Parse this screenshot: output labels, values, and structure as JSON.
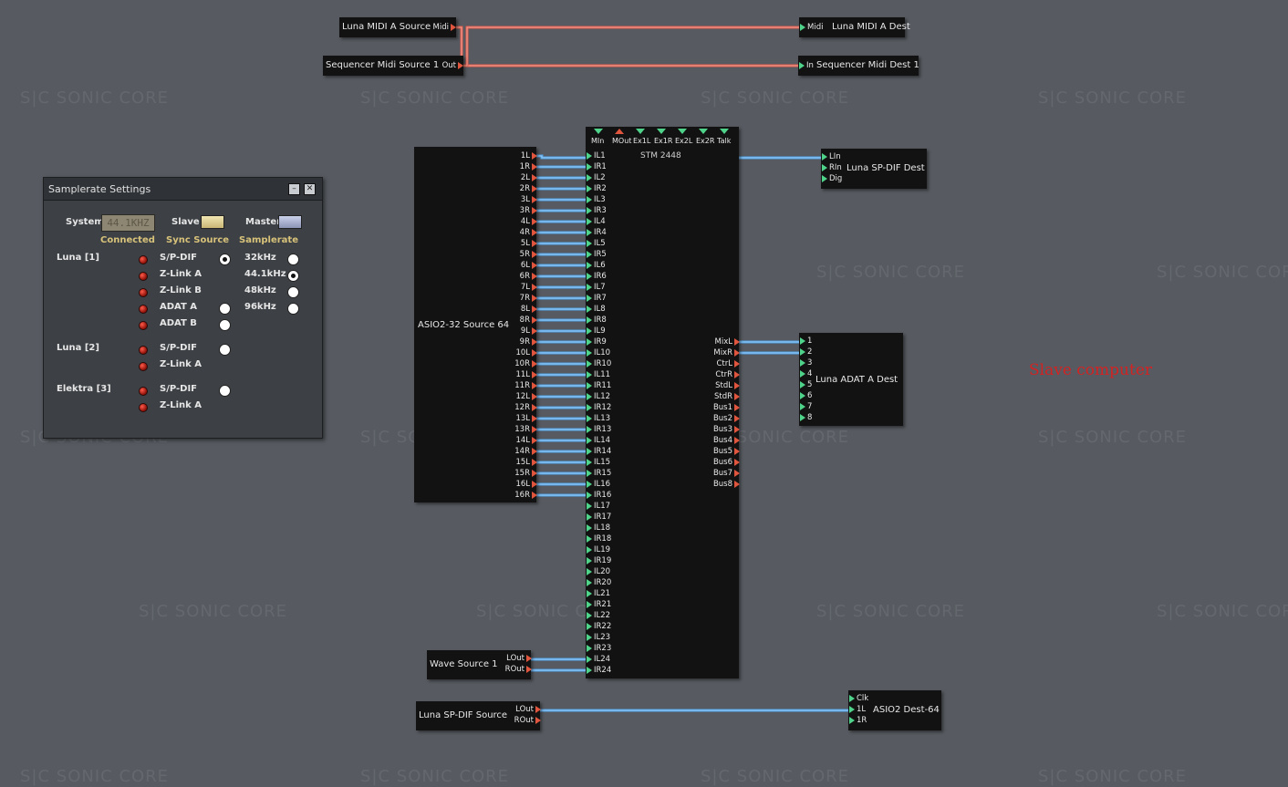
{
  "watermark": "S|C  SONIC CORE",
  "colors": {
    "background": "#575b61",
    "cable_midi": "#e05a4a",
    "cable_audio": "#4fa3e8",
    "port_in": "#4fd38a",
    "port_out": "#e0553d",
    "annotation_red": "#d32222"
  },
  "midi_modules": {
    "luna_midi_src": {
      "title": "Luna MIDI A Source",
      "port": "Midi"
    },
    "seq_midi_src": {
      "title": "Sequencer Midi Source 1",
      "port": "Out"
    },
    "luna_midi_dest": {
      "title": "Luna MIDI A Dest",
      "port": "Midi"
    },
    "seq_midi_dest": {
      "title": "Sequencer Midi Dest 1",
      "port": "In"
    }
  },
  "asio_source": {
    "title": "ASIO2-32 Source 64",
    "ports": [
      "1L",
      "1R",
      "2L",
      "2R",
      "3L",
      "3R",
      "4L",
      "4R",
      "5L",
      "5R",
      "6L",
      "6R",
      "7L",
      "7R",
      "8L",
      "8R",
      "9L",
      "9R",
      "10L",
      "10R",
      "11L",
      "11R",
      "12L",
      "12R",
      "13L",
      "13R",
      "14L",
      "14R",
      "15L",
      "15R",
      "16L",
      "16R"
    ]
  },
  "stm": {
    "title": "STM 2448",
    "top_ports": [
      {
        "label": "MIn",
        "dir": "in"
      },
      {
        "label": "MOut",
        "dir": "out"
      },
      {
        "label": "Ex1L",
        "dir": "in"
      },
      {
        "label": "Ex1R",
        "dir": "in"
      },
      {
        "label": "Ex2L",
        "dir": "in"
      },
      {
        "label": "Ex2R",
        "dir": "in"
      },
      {
        "label": "Talk",
        "dir": "in"
      }
    ],
    "inputs": [
      "IL1",
      "IR1",
      "IL2",
      "IR2",
      "IL3",
      "IR3",
      "IL4",
      "IR4",
      "IL5",
      "IR5",
      "IL6",
      "IR6",
      "IL7",
      "IR7",
      "IL8",
      "IR8",
      "IL9",
      "IR9",
      "IL10",
      "IR10",
      "IL11",
      "IR11",
      "IL12",
      "IR12",
      "IL13",
      "IR13",
      "IL14",
      "IR14",
      "IL15",
      "IR15",
      "IL16",
      "IR16",
      "IL17",
      "IR17",
      "IL18",
      "IR18",
      "IL19",
      "IR19",
      "IL20",
      "IR20",
      "IL21",
      "IR21",
      "IL22",
      "IR22",
      "IL23",
      "IR23",
      "IL24",
      "IR24"
    ],
    "outputs": [
      "MixL",
      "MixR",
      "CtrL",
      "CtrR",
      "StdL",
      "StdR",
      "Bus1",
      "Bus2",
      "Bus3",
      "Bus4",
      "Bus5",
      "Bus6",
      "Bus7",
      "Bus8"
    ]
  },
  "luna_spdif_dest": {
    "title": "Luna SP-DIF Dest",
    "ports": [
      "LIn",
      "RIn",
      "Dig"
    ]
  },
  "luna_adat_dest": {
    "title": "Luna ADAT A Dest",
    "ports": [
      "1",
      "2",
      "3",
      "4",
      "5",
      "6",
      "7",
      "8"
    ]
  },
  "wave_source": {
    "title": "Wave Source 1",
    "ports": [
      "LOut",
      "ROut"
    ]
  },
  "luna_spdif_source": {
    "title": "Luna SP-DIF Source",
    "ports": [
      "LOut",
      "ROut"
    ]
  },
  "asio_dest": {
    "title": "ASIO2 Dest-64",
    "ports": [
      "Clk",
      "1L",
      "1R"
    ]
  },
  "annotation": "Slave computer",
  "samplerate_panel": {
    "title": "Samplerate Settings",
    "system_label": "System",
    "system_value": "44.1KHZ",
    "slave_label": "Slave",
    "master_label": "Master",
    "col_connected": "Connected",
    "col_sync": "Sync Source",
    "col_samplerate": "Samplerate",
    "devices": [
      {
        "name": "Luna [1]",
        "sources": [
          "S/P-DIF",
          "Z-Link A",
          "Z-Link B",
          "ADAT A",
          "ADAT B"
        ]
      },
      {
        "name": "Luna [2]",
        "sources": [
          "S/P-DIF",
          "Z-Link A"
        ]
      },
      {
        "name": "Elektra [3]",
        "sources": [
          "S/P-DIF",
          "Z-Link A"
        ]
      }
    ],
    "rates": [
      "32kHz",
      "44.1kHz",
      "48kHz",
      "96kHz"
    ],
    "selected_rate": "44.1kHz",
    "selected_sync": "Luna [1] S/P-DIF"
  }
}
